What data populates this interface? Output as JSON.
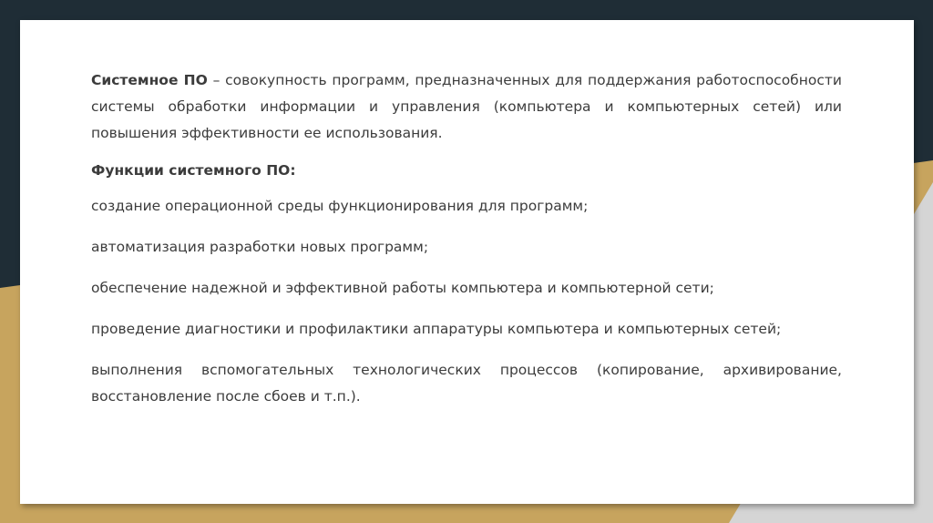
{
  "definition": {
    "term": "Системное ПО",
    "text": " – совокупность программ, предназначенных для поддержания работоспособности системы обработки информации и управления (компьютера и компьютерных сетей) или повышения эффективности ее использования."
  },
  "functions": {
    "heading": "Функции системного ПО:",
    "items": [
      "создание операционной среды функционирования для программ;",
      "автоматизация разработки новых программ;",
      "обеспечение надежной и эффективной работы компьютера и компьютерной сети;",
      "проведение диагностики и профилактики аппаратуры компьютера и компьютерных сетей;",
      "выполнения вспомогательных технологических процессов (копирование, архивирование, восстановление после сбоев и т.п.)."
    ]
  },
  "colors": {
    "background_dark": "#1f2d36",
    "accent_gold": "#c7a45e",
    "slide_background": "#ffffff",
    "text": "#3c3c3c"
  }
}
